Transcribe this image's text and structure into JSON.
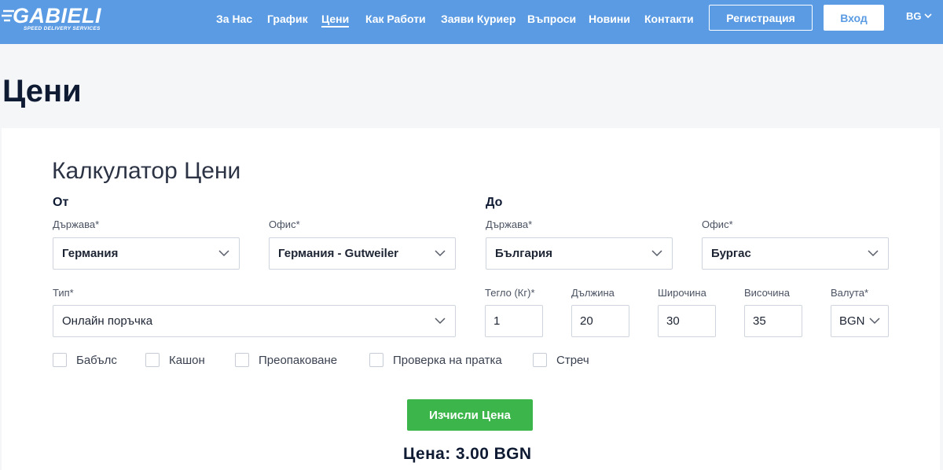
{
  "brand": {
    "name": "GABIELI",
    "tagline": "SPEED DELIVERY SERVICES"
  },
  "nav": {
    "items": [
      "За Нас",
      "График",
      "Цени",
      "Как Работи",
      "Заяви Куриер",
      "Въпроси",
      "Новини",
      "Контакти"
    ],
    "active": "Цени",
    "register_label": "Регистрация",
    "login_label": "Вход",
    "language": "BG"
  },
  "page": {
    "title": "Цени"
  },
  "calculator": {
    "title": "Калкулатор Цени",
    "from": {
      "heading": "От",
      "country_label": "Държава*",
      "country_value": "Германия",
      "office_label": "Офис*",
      "office_value": "Германия - Gutweiler"
    },
    "to": {
      "heading": "До",
      "country_label": "Държава*",
      "country_value": "България",
      "office_label": "Офис*",
      "office_value": "Бургас"
    },
    "type_label": "Тип*",
    "type_value": "Онлайн поръчка",
    "weight_label": "Тегло (Кг)*",
    "weight_value": "1",
    "length_label": "Дължина",
    "length_value": "20",
    "width_label": "Широчина",
    "width_value": "30",
    "height_label": "Височина",
    "height_value": "35",
    "currency_label": "Валута*",
    "currency_value": "BGN",
    "options": [
      "Бабълс",
      "Кашон",
      "Преопаковане",
      "Проверка на пратка",
      "Стреч"
    ],
    "calculate_label": "Изчисли Цена",
    "price_text": "Цена: 3.00 BGN"
  },
  "colors": {
    "header": "#5b9be3",
    "button_green": "#3cb64a",
    "title_dark": "#0f1a33"
  },
  "icons": {
    "chevron": "chevron-down-icon",
    "checkbox": "checkbox-icon"
  }
}
